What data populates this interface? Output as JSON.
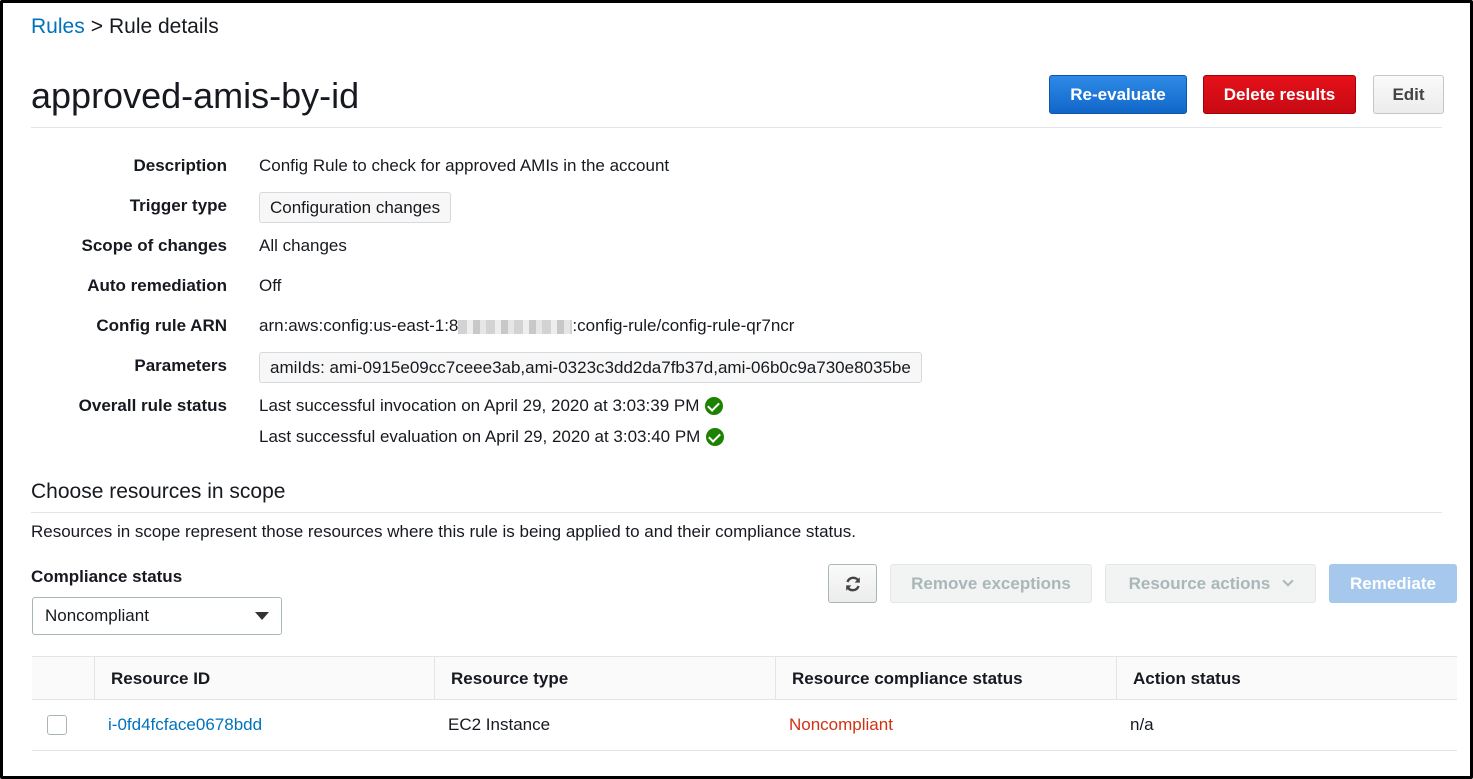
{
  "breadcrumb": {
    "parent": "Rules",
    "separator": ">",
    "current": "Rule details"
  },
  "page": {
    "title": "approved-amis-by-id"
  },
  "actions": {
    "reevaluate": "Re-evaluate",
    "delete_results": "Delete results",
    "edit": "Edit"
  },
  "details": {
    "description_label": "Description",
    "description": "Config Rule to check for approved AMIs in the account",
    "trigger_label": "Trigger type",
    "trigger": "Configuration changes",
    "scope_label": "Scope of changes",
    "scope": "All changes",
    "remediation_label": "Auto remediation",
    "remediation": "Off",
    "arn_label": "Config rule ARN",
    "arn_prefix": "arn:aws:config:us-east-1:8",
    "arn_suffix": ":config-rule/config-rule-qr7ncr",
    "parameters_label": "Parameters",
    "parameters": "amiIds: ami-0915e09cc7ceee3ab,ami-0323c3dd2da7fb37d,ami-06b0c9a730e8035be",
    "status_label": "Overall rule status",
    "status_invocation": "Last successful invocation on April 29, 2020 at 3:03:39 PM",
    "status_evaluation": "Last successful evaluation on April 29, 2020 at 3:03:40 PM"
  },
  "scope_section": {
    "title": "Choose resources in scope",
    "description": "Resources in scope represent those resources where this rule is being applied to and their compliance status.",
    "filter_label": "Compliance status",
    "filter_value": "Noncompliant",
    "remove_exceptions": "Remove exceptions",
    "resource_actions": "Resource actions",
    "remediate": "Remediate"
  },
  "table": {
    "columns": [
      "Resource ID",
      "Resource type",
      "Resource compliance status",
      "Action status"
    ],
    "rows": [
      {
        "resource_id": "i-0fd4fcface0678bdd",
        "resource_type": "EC2 Instance",
        "compliance": "Noncompliant",
        "action_status": "n/a"
      }
    ]
  },
  "colors": {
    "link": "#0073bb",
    "primary": "#1167c9",
    "danger": "#d0021b",
    "noncompliant": "#d13212",
    "success": "#1d8102"
  },
  "icons": {
    "status_ok": "check-circle-icon",
    "refresh": "refresh-icon",
    "dropdown": "caret-down-icon"
  }
}
